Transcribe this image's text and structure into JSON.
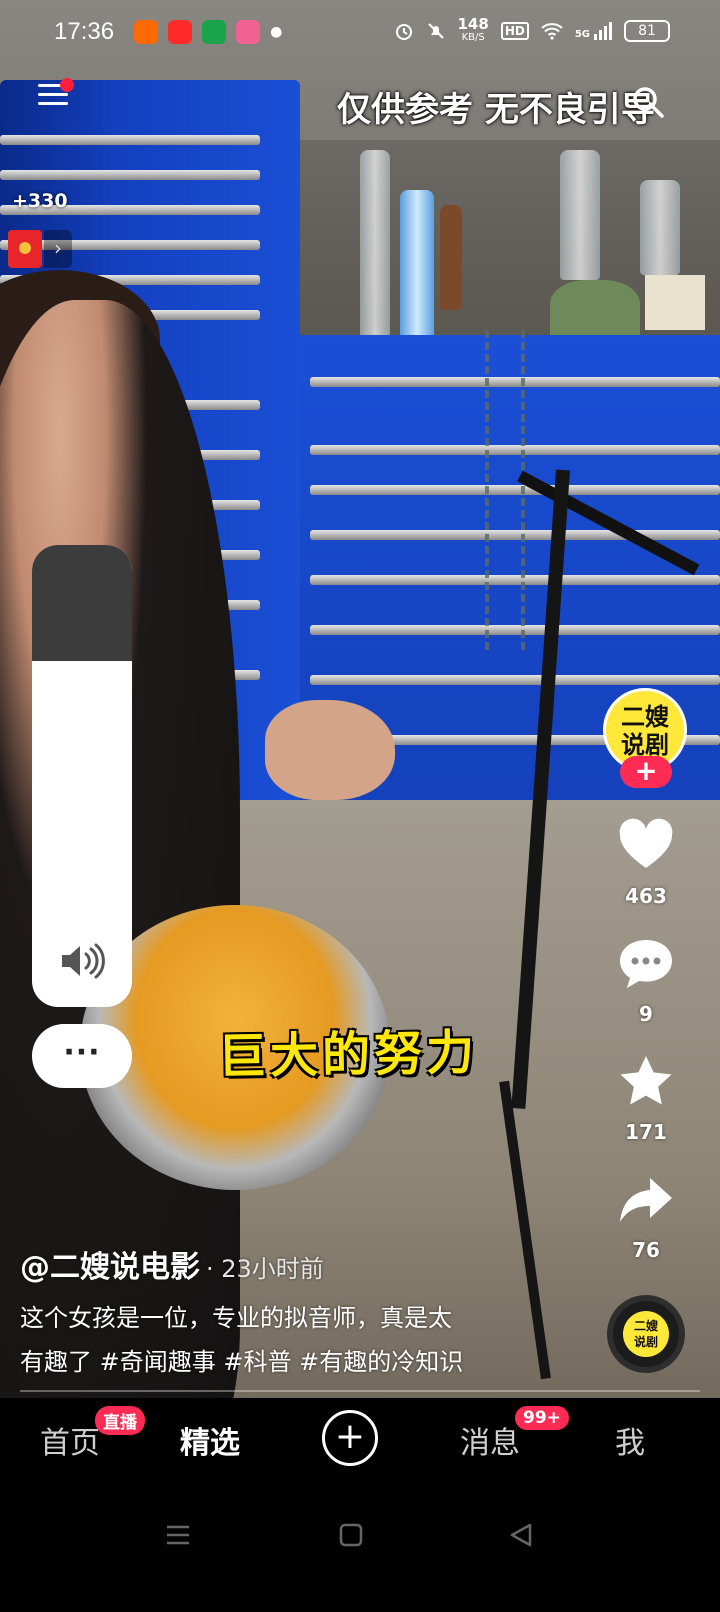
{
  "status_bar": {
    "time": "17:36",
    "net_speed": "148",
    "net_unit": "KB/S",
    "hd": "HD",
    "signal": "5G",
    "battery": "81"
  },
  "overlay": {
    "disclaimer": "仅供参考 无不良引导",
    "points": "+330",
    "subtitle": "巨大的努力"
  },
  "right_rail": {
    "avatar_text_line1": "二嫂",
    "avatar_text_line2": "说剧",
    "follow_label": "+",
    "likes": "463",
    "comments": "9",
    "favorites": "171",
    "shares": "76"
  },
  "post": {
    "author": "@二嫂说电影",
    "time_ago": "· 23小时前",
    "description_line1": "这个女孩是一位，专业的拟音师，真是太",
    "description_line2": "有趣了 #奇闻趣事 #科普 #有趣的冷知识",
    "music_disc_line1": "二嫂",
    "music_disc_line2": "说剧"
  },
  "volume_panel": {
    "level": 0.75,
    "more_label": "···"
  },
  "bottom_nav": {
    "home": "首页",
    "home_badge": "直播",
    "featured": "精选",
    "add": "+",
    "messages": "消息",
    "messages_badge": "99+",
    "me": "我"
  },
  "colors": {
    "accent": "#fe2c55",
    "avatar_yellow": "#ffe83a",
    "subtitle_yellow": "#ffe70a"
  }
}
